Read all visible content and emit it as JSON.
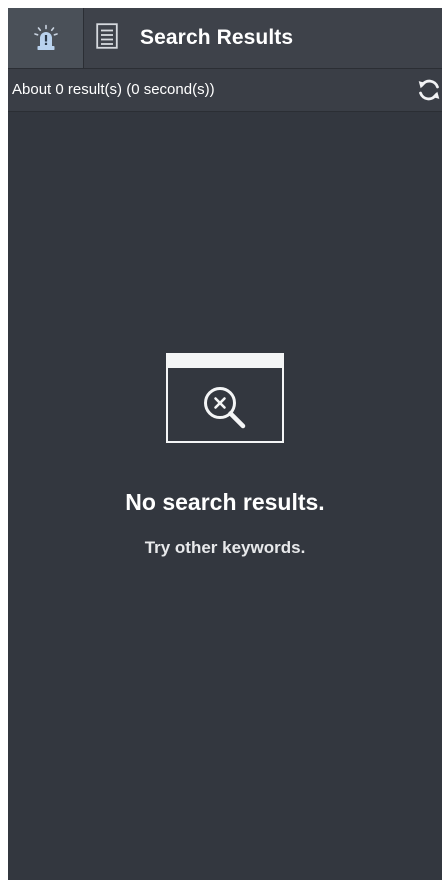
{
  "tabs": {
    "alert_tab": {
      "icon": "alarm-light-icon",
      "active": true
    },
    "search_tab": {
      "icon": "document-list-icon",
      "label": "Search Results"
    }
  },
  "status": {
    "summary": "About 0 result(s) (0 second(s))",
    "refresh_icon": "refresh-icon"
  },
  "empty_state": {
    "icon": "window-search-cancel-icon",
    "title": "No search results.",
    "subtitle": "Try other keywords."
  },
  "colors": {
    "background": "#33373f",
    "tabbar": "#3e424a",
    "active_tab": "#4a5058",
    "text": "#ffffff"
  }
}
